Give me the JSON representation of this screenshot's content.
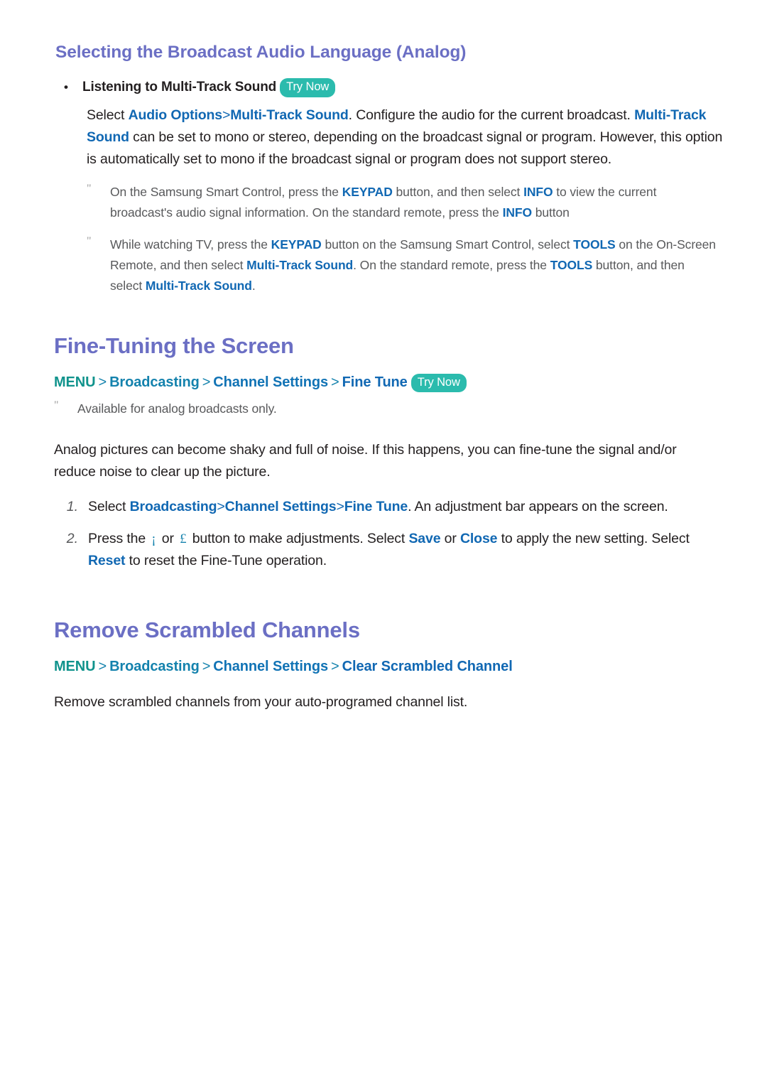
{
  "section_audio_language": {
    "heading": "Selecting the Broadcast Audio Language (Analog)",
    "bullet": {
      "marker": "•",
      "label": "Listening to Multi-Track Sound",
      "badge": "Try Now"
    },
    "paragraph": {
      "p1": "Select ",
      "link_audio_options": "Audio Options",
      "sep1": ">",
      "link_multi_track_sound": "Multi-Track Sound",
      "p2": ". Configure the audio for the current broadcast. ",
      "link_multi_track_sound_2": "Multi-Track Sound",
      "p3": " can be set to mono or stereo, depending on the broadcast signal or program. However, this option is automatically set to mono if the broadcast signal or program does not support stereo."
    },
    "notes": [
      {
        "marker": "\"",
        "p1": "On the Samsung Smart Control, press the ",
        "key1": "KEYPAD",
        "p2": " button, and then select ",
        "key2": "INFO",
        "p3": " to view the current broadcast's audio signal information. On the standard remote, press the ",
        "key3": "INFO",
        "p4": " button"
      },
      {
        "marker": "\"",
        "p1": "While watching TV, press the ",
        "key1": "KEYPAD",
        "p2": " button on the Samsung Smart Control, select ",
        "key2": "TOOLS",
        "p3": " on the On-Screen Remote, and then select ",
        "key3": "Multi-Track Sound",
        "p4": ". On the standard remote, press the ",
        "key4": "TOOLS",
        "p5": " button, and then select ",
        "key5": "Multi-Track Sound",
        "p6": "."
      }
    ]
  },
  "section_fine_tuning": {
    "heading": "Fine-Tuning the Screen",
    "menu_path": {
      "item1": "MENU",
      "item2": "Broadcasting",
      "item3": "Channel Settings",
      "item4": "Fine Tune",
      "arrow": ">",
      "badge": "Try Now"
    },
    "note": {
      "marker": "\"",
      "text": "Available for analog broadcasts only."
    },
    "intro": "Analog pictures can become shaky and full of noise. If this happens, you can fine-tune the signal and/or reduce noise to clear up the picture.",
    "steps": [
      {
        "number": "1.",
        "p1": "Select ",
        "link1": "Broadcasting",
        "sep1": ">",
        "link2": "Channel Settings",
        "sep2": ">",
        "link3": "Fine Tune",
        "p2": ". An adjustment bar appears on the screen."
      },
      {
        "number": "2.",
        "p1": "Press the ",
        "glyph1": "¡",
        "p2": " or ",
        "glyph2": "£",
        "p3": " button to make adjustments. Select ",
        "link1": "Save",
        "p4": " or ",
        "link2": "Close",
        "p5": " to apply the new setting. Select ",
        "link3": "Reset",
        "p6": " to reset the Fine-Tune operation."
      }
    ]
  },
  "section_remove_scrambled": {
    "heading": "Remove Scrambled Channels",
    "menu_path": {
      "item1": "MENU",
      "item2": "Broadcasting",
      "item3": "Channel Settings",
      "item4": "Clear Scrambled Channel",
      "arrow": ">"
    },
    "body": "Remove scrambled channels from your auto-programed channel list."
  },
  "colors": {
    "heading": "#6B6FC4",
    "link_blue": "#1168B3",
    "menu_teal": "#10938C",
    "badge_bg": "#2BBBAD",
    "body_text": "#231F20",
    "note_text": "#58595B"
  }
}
